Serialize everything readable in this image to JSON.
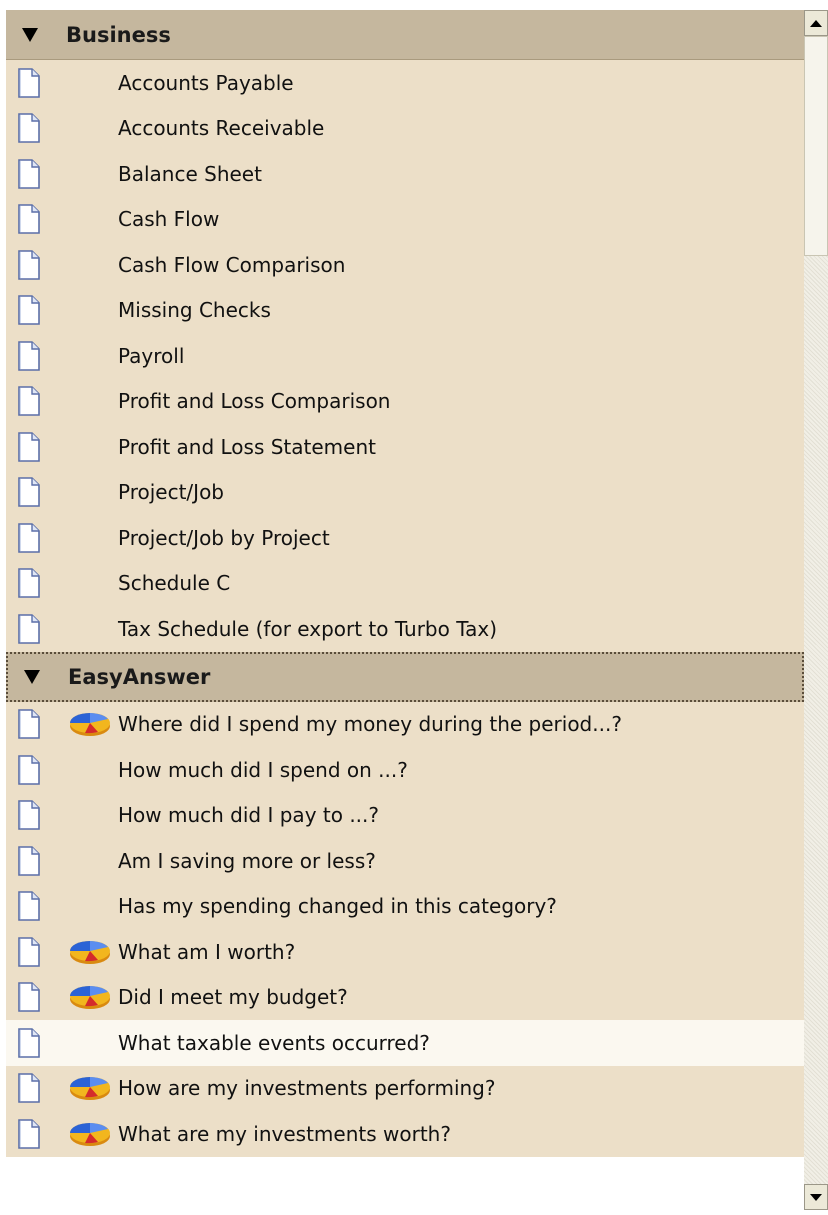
{
  "sections": [
    {
      "title": "Business",
      "items": [
        {
          "label": "Accounts Payable",
          "pie": false
        },
        {
          "label": "Accounts Receivable",
          "pie": false
        },
        {
          "label": "Balance Sheet",
          "pie": false
        },
        {
          "label": "Cash Flow",
          "pie": false
        },
        {
          "label": "Cash Flow Comparison",
          "pie": false
        },
        {
          "label": "Missing Checks",
          "pie": false
        },
        {
          "label": "Payroll",
          "pie": false
        },
        {
          "label": "Profit and Loss Comparison",
          "pie": false
        },
        {
          "label": "Profit and Loss Statement",
          "pie": false
        },
        {
          "label": "Project/Job",
          "pie": false
        },
        {
          "label": "Project/Job by Project",
          "pie": false
        },
        {
          "label": "Schedule C",
          "pie": false
        },
        {
          "label": "Tax Schedule (for export to Turbo Tax)",
          "pie": false
        }
      ]
    },
    {
      "title": "EasyAnswer",
      "items": [
        {
          "label": "Where did I spend my money during the period...?",
          "pie": true
        },
        {
          "label": "How much did I spend on ...?",
          "pie": false
        },
        {
          "label": "How much did I pay to ...?",
          "pie": false
        },
        {
          "label": "Am I saving more or less?",
          "pie": false
        },
        {
          "label": "Has my spending changed in this category?",
          "pie": false
        },
        {
          "label": "What am I worth?",
          "pie": true
        },
        {
          "label": "Did I meet my budget?",
          "pie": true
        },
        {
          "label": "What taxable events occurred?",
          "pie": false,
          "hover": true
        },
        {
          "label": "How are my investments performing?",
          "pie": true
        },
        {
          "label": "What are my investments worth?",
          "pie": true
        }
      ]
    }
  ],
  "icons": {
    "expand": "triangle-down-icon",
    "document": "document-icon",
    "chart": "pie-chart-icon"
  },
  "colors": {
    "header_bg": "#c5b79e",
    "row_bg": "#ecdfc8",
    "row_hover_bg": "#fbf8f0"
  }
}
